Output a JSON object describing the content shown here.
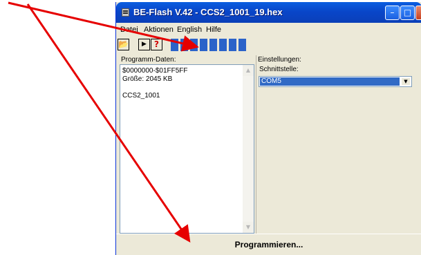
{
  "window": {
    "title": "BE-Flash V.42 - CCS2_1001_19.hex",
    "title_buttons": {
      "minimize": "–",
      "maximize": "□",
      "close": ""
    }
  },
  "menu": [
    "Datei",
    "Aktionen",
    "English",
    "Hilfe"
  ],
  "toolbar": {
    "open_icon": "folder-open-icon",
    "flash_icon": "play-icon",
    "help_glyph": "?",
    "progress_segments": 8,
    "progress_fraction": 1.0,
    "progress_color": "#2b63c9"
  },
  "program_panel": {
    "label": "Programm-Daten:",
    "lines": [
      "$0000000-$01FF5FF",
      "Größe: 2045 KB",
      "",
      "CCS2_1001"
    ]
  },
  "settings_panel": {
    "label": "Einstellungen:",
    "interface_label": "Schnittstelle:",
    "interface_value": "COM5"
  },
  "program_button": {
    "label": "Programmieren..."
  },
  "annotations": {
    "arrow_color": "#e60000",
    "arrow_count": 2
  }
}
